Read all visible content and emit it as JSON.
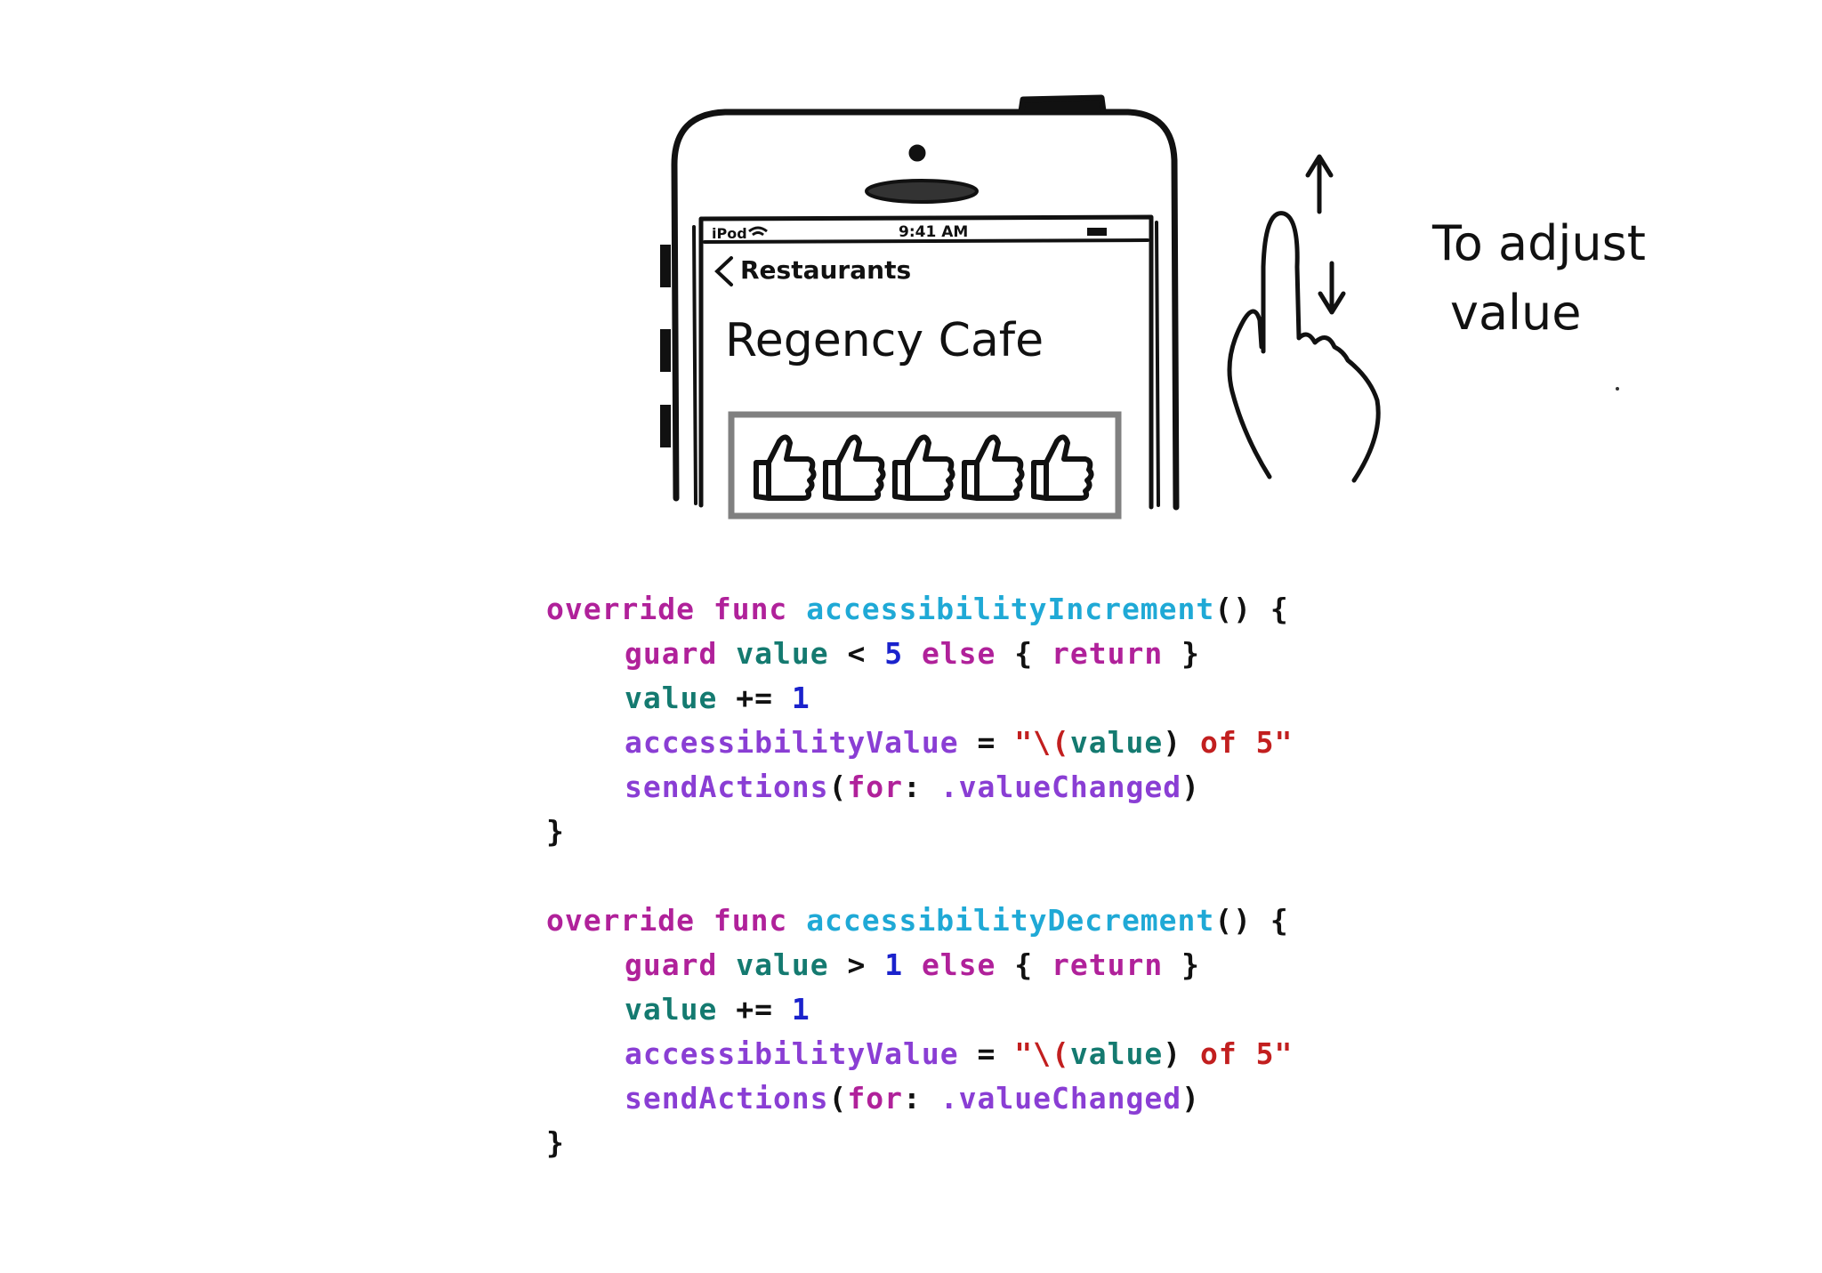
{
  "colors": {
    "keyword": "#b0219a",
    "function_name": "#1fa9d6",
    "identifier": "#147a70",
    "number": "#1a22cc",
    "api": "#8a3ed4",
    "string": "#c21f1f",
    "punctuation": "#111111",
    "rating_frame": "#808080"
  },
  "phone": {
    "status_left": "iPod",
    "status_time": "9:41 AM",
    "back_label": "Restaurants",
    "title": "Regency Cafe",
    "rating_icons": [
      "thumbs-up-icon",
      "thumbs-up-icon",
      "thumbs-up-icon",
      "thumbs-up-icon",
      "thumbs-up-icon"
    ]
  },
  "gesture": {
    "caption_line1": "To adjust",
    "caption_line2": "value",
    "icon": "finger-swipe-up-down-icon"
  },
  "code": {
    "increment": {
      "l1": {
        "a": "override",
        "b": "func",
        "c": "accessibilityIncrement",
        "d": "() {"
      },
      "l2": {
        "a": "guard",
        "b": "value",
        "c": "<",
        "d": "5",
        "e": "else",
        "f": "{",
        "g": "return",
        "h": "}"
      },
      "l3": {
        "a": "value",
        "b": "+=",
        "c": "1"
      },
      "l4": {
        "a": "accessibilityValue",
        "b": "=",
        "c": "\"\\(",
        "d": "value",
        "e": ")",
        "f": "of",
        "g": "5\""
      },
      "l5": {
        "a": "sendActions",
        "b": "(",
        "c": "for",
        "d": ":",
        "e": ".valueChanged",
        "f": ")"
      },
      "l6": "}"
    },
    "decrement": {
      "l1": {
        "a": "override",
        "b": "func",
        "c": "accessibilityDecrement",
        "d": "() {"
      },
      "l2": {
        "a": "guard",
        "b": "value",
        "c": ">",
        "d": "1",
        "e": "else",
        "f": "{",
        "g": "return",
        "h": "}"
      },
      "l3": {
        "a": "value",
        "b": "+=",
        "c": "1"
      },
      "l4": {
        "a": "accessibilityValue",
        "b": "=",
        "c": "\"\\(",
        "d": "value",
        "e": ")",
        "f": "of",
        "g": "5\""
      },
      "l5": {
        "a": "sendActions",
        "b": "(",
        "c": "for",
        "d": ":",
        "e": ".valueChanged",
        "f": ")"
      },
      "l6": "}"
    }
  }
}
